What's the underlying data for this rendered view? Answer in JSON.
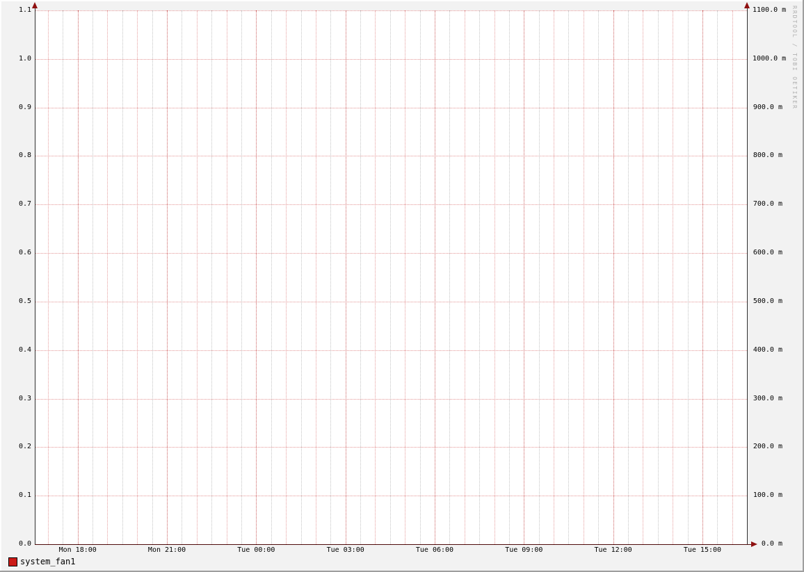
{
  "chart_data": {
    "type": "line",
    "title": "",
    "x_tick_labels": [
      "Mon 18:00",
      "Mon 21:00",
      "Tue 00:00",
      "Tue 03:00",
      "Tue 06:00",
      "Tue 09:00",
      "Tue 12:00",
      "Tue 15:00"
    ],
    "y_left_axis": {
      "ticks": [
        "1.1",
        "1.0",
        "0.9",
        "0.8",
        "0.7",
        "0.6",
        "0.5",
        "0.4",
        "0.3",
        "0.2",
        "0.1",
        "0.0"
      ],
      "range": [
        0.0,
        1.1
      ],
      "tick_step": 0.1
    },
    "y_right_axis": {
      "ticks": [
        "1100.0 m",
        "1000.0 m",
        "900.0 m",
        "800.0 m",
        "700.0 m",
        "600.0 m",
        "500.0 m",
        "400.0 m",
        "300.0 m",
        "200.0 m",
        "100.0 m",
        "0.0 m"
      ],
      "range_milli": [
        0,
        1100
      ],
      "tick_step_milli": 100
    },
    "grid": {
      "vertical_minor_interval": "30 min",
      "vertical_major_interval": "1 hour",
      "x_label_interval": "3 hours",
      "horizontal_interval": 0.1,
      "grid_on": true
    },
    "series": [
      {
        "name": "system_fan1",
        "color": "#cb1b17",
        "values_visible": "flat at 0.0 along the x-axis baseline (no excursions drawn in plot area)"
      }
    ],
    "legend_position": "bottom-left"
  },
  "legend": {
    "items": [
      {
        "label": "system_fan1",
        "color": "#cb1b17"
      }
    ]
  },
  "watermark_text": "RRDTOOL / TOBI OETIKER",
  "icons": {
    "legend_swatch": "red-square-swatch",
    "axis_arrows": "dark-red-arrowheads"
  },
  "colors": {
    "background": "#f2f2f2",
    "canvas": "#ffffff",
    "grid_major_red": "#ce3e3e",
    "grid_minor_gray": "#7d7d7d",
    "axis_dark": "#2e2e2e",
    "x_axis_baseline": "#4e0c0c",
    "arrow": "#8f1010",
    "legend_swatch": "#cb1b17",
    "watermark": "#b0b0b0",
    "text": "#000000",
    "bevel_light": "#fdfdfd",
    "bevel_dark": "#9e9e9e"
  }
}
